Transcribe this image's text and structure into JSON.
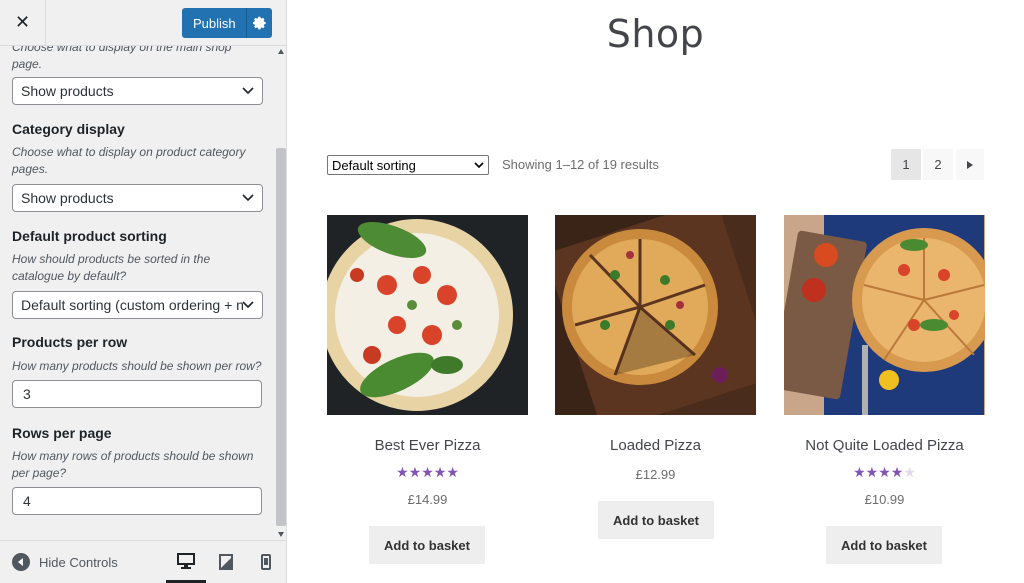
{
  "topbar": {
    "close_glyph": "✕",
    "publish_label": "Publish"
  },
  "panel": {
    "shop_page_desc": "Choose what to display on the main shop page.",
    "shop_page_value": "Show products",
    "category_label": "Category display",
    "category_desc": "Choose what to display on product category pages.",
    "category_value": "Show products",
    "sorting_label": "Default product sorting",
    "sorting_desc": "How should products be sorted in the catalogue by default?",
    "sorting_value": "Default sorting (custom ordering + n",
    "per_row_label": "Products per row",
    "per_row_desc": "How many products should be shown per row?",
    "per_row_value": "3",
    "rows_label": "Rows per page",
    "rows_desc": "How many rows of products should be shown per page?",
    "rows_value": "4"
  },
  "footer": {
    "hide_controls_label": "Hide Controls",
    "devices": [
      "desktop-icon",
      "tablet-icon",
      "mobile-icon"
    ]
  },
  "preview": {
    "title": "Shop",
    "sort_value": "Default sorting",
    "results_text": "Showing 1–12 of 19 results",
    "pagination": {
      "current": "1",
      "next_page": "2",
      "next_glyph": "▶"
    },
    "products": [
      {
        "name": "Best Ever Pizza",
        "price": "£14.99",
        "rating": 5,
        "button": "Add to basket"
      },
      {
        "name": "Loaded Pizza",
        "price": "£12.99",
        "rating": 0,
        "button": "Add to basket"
      },
      {
        "name": "Not Quite Loaded Pizza",
        "price": "£10.99",
        "rating": 4,
        "button": "Add to basket"
      }
    ]
  },
  "colors": {
    "accent": "#2271b1",
    "star": "#7f54b3",
    "star_empty": "#e2d9ef"
  }
}
